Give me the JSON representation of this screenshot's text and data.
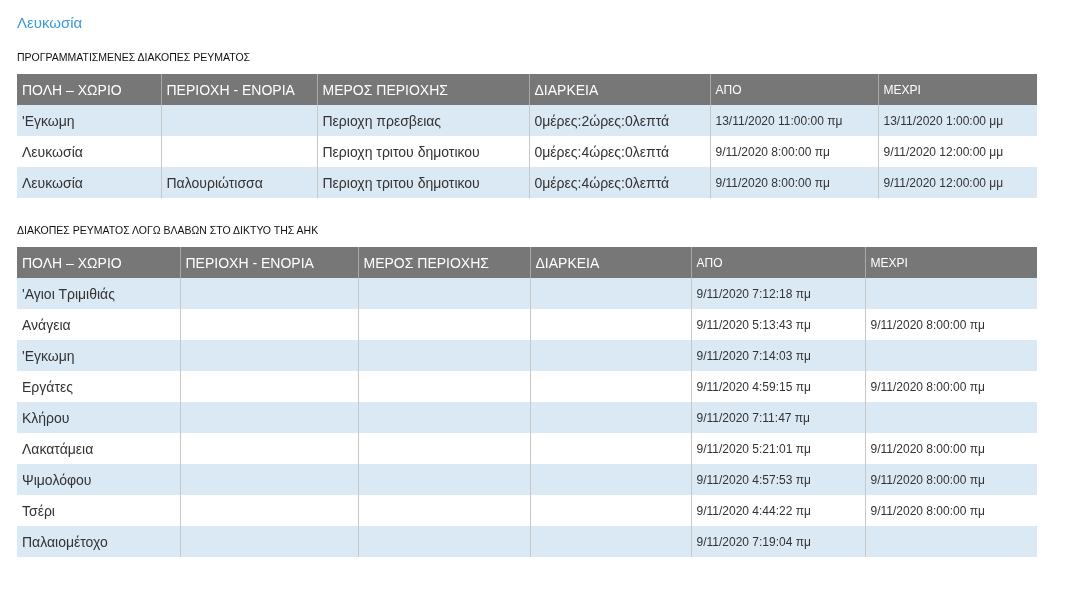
{
  "title": "Λευκωσία",
  "sections": [
    {
      "heading": "ΠΡΟΓΡΑΜΜΑΤΙΣΜΕΝΕΣ ΔΙΑΚΟΠΕΣ ΡΕΥΜΑΤΟΣ",
      "columns": [
        {
          "label": "ΠΟΛΗ – ΧΩΡΙΟ",
          "kind": "text"
        },
        {
          "label": "ΠΕΡΙΟΧΗ - ΕΝΟΡΙΑ",
          "kind": "text"
        },
        {
          "label": "ΜΕΡΟΣ ΠΕΡΙΟΧΗΣ",
          "kind": "text"
        },
        {
          "label": "ΔΙΑΡΚΕΙΑ",
          "kind": "text"
        },
        {
          "label": "ΑΠΟ",
          "kind": "date"
        },
        {
          "label": "ΜΕΧΡΙ",
          "kind": "date"
        }
      ],
      "rows": [
        [
          "'Εγκωμη",
          null,
          "Περιοχη πρεσβειας",
          "0μέρες:2ώρες:0λεπτά",
          "13/11/2020 11:00:00 πμ",
          "13/11/2020 1:00:00 μμ"
        ],
        [
          "Λευκωσία",
          null,
          "Περιοχη τριτου δημοτικου",
          "0μέρες:4ώρες:0λεπτά",
          "9/11/2020 8:00:00 πμ",
          "9/11/2020 12:00:00 μμ"
        ],
        [
          "Λευκωσία",
          "Παλουριώτισσα",
          "Περιοχη τριτου δημοτικου",
          "0μέρες:4ώρες:0λεπτά",
          "9/11/2020 8:00:00 πμ",
          "9/11/2020 12:00:00 μμ"
        ]
      ]
    },
    {
      "heading": "ΔΙΑΚΟΠΕΣ ΡΕΥΜΑΤΟΣ ΛΟΓΩ ΒΛΑΒΩΝ ΣΤΟ ΔΙΚΤΥΟ ΤΗΣ ΑΗΚ",
      "columns": [
        {
          "label": "ΠΟΛΗ – ΧΩΡΙΟ",
          "kind": "text"
        },
        {
          "label": "ΠΕΡΙΟΧΗ - ΕΝΟΡΙΑ",
          "kind": "text"
        },
        {
          "label": "ΜΕΡΟΣ ΠΕΡΙΟΧΗΣ",
          "kind": "text"
        },
        {
          "label": "ΔΙΑΡΚΕΙΑ",
          "kind": "text"
        },
        {
          "label": "ΑΠΟ",
          "kind": "date"
        },
        {
          "label": "ΜΕΧΡΙ",
          "kind": "date"
        }
      ],
      "rows": [
        [
          "'Αγιοι Τριμιθιάς",
          null,
          null,
          null,
          "9/11/2020 7:12:18 πμ",
          null
        ],
        [
          "Ανάγεια",
          null,
          null,
          null,
          "9/11/2020 5:13:43 πμ",
          "9/11/2020 8:00:00 πμ"
        ],
        [
          "'Εγκωμη",
          null,
          null,
          null,
          "9/11/2020 7:14:03 πμ",
          null
        ],
        [
          "Εργάτες",
          null,
          null,
          null,
          "9/11/2020 4:59:15 πμ",
          "9/11/2020 8:00:00 πμ"
        ],
        [
          "Κλήρου",
          null,
          null,
          null,
          "9/11/2020 7:11:47 πμ",
          null
        ],
        [
          "Λακατάμεια",
          null,
          null,
          null,
          "9/11/2020 5:21:01 πμ",
          "9/11/2020 8:00:00 πμ"
        ],
        [
          "Ψιμολόφου",
          null,
          null,
          null,
          "9/11/2020 4:57:53 πμ",
          "9/11/2020 8:00:00 πμ"
        ],
        [
          "Τσέρι",
          null,
          null,
          null,
          "9/11/2020 4:44:22 πμ",
          "9/11/2020 8:00:00 πμ"
        ],
        [
          "Παλαιομέτοχο",
          null,
          null,
          null,
          "9/11/2020 7:19:04 πμ",
          null
        ]
      ]
    }
  ]
}
